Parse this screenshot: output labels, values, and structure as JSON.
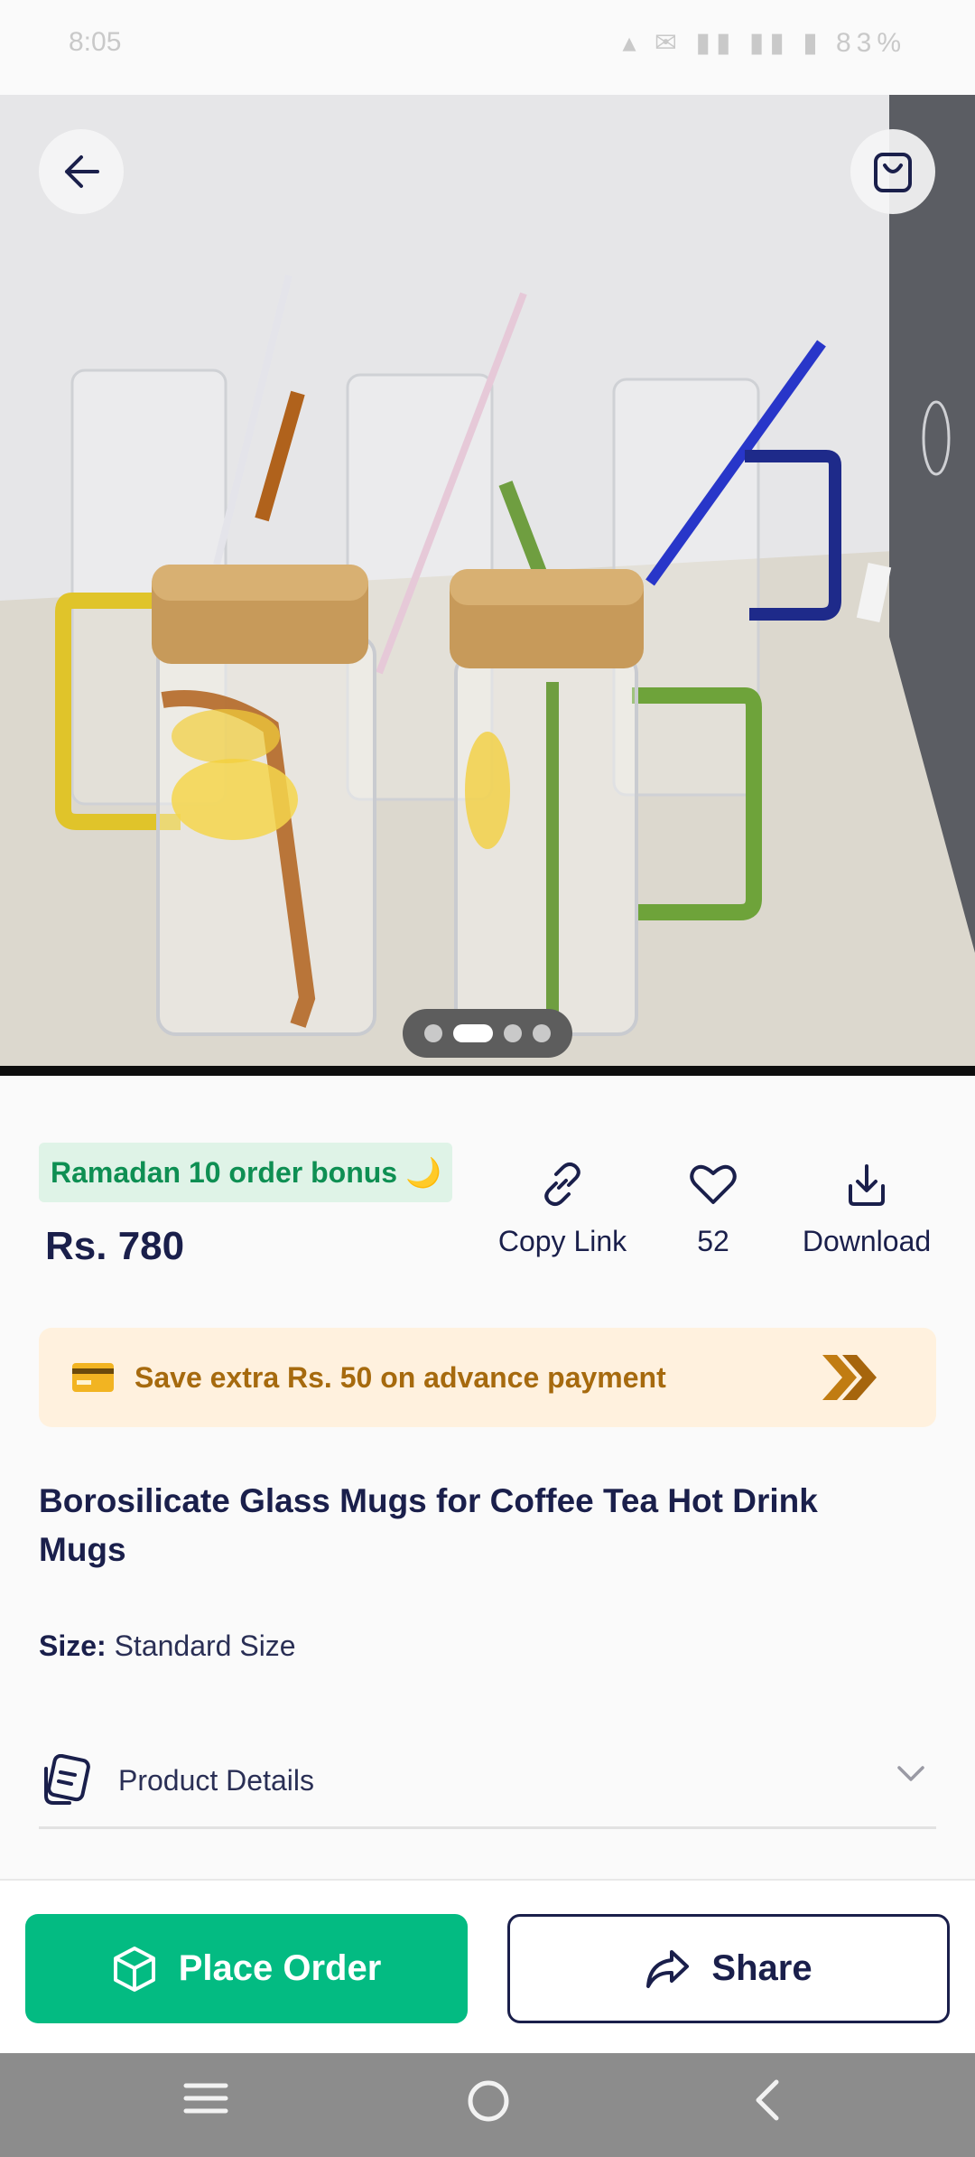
{
  "status_bar": {
    "time": "8:05",
    "indicators": "▴ ✉ ▮▮ ▮▮ ▮ 83%"
  },
  "header": {
    "back_icon": "arrow-left-icon",
    "cart_icon": "shopping-bag-icon"
  },
  "gallery": {
    "image_count": 4,
    "active_index": 1,
    "image_subject": "glass mugs with bamboo lids and glass straws"
  },
  "promo": {
    "bonus_label": "Ramadan 10 order bonus 🌙",
    "price": "Rs. 780"
  },
  "actions": [
    {
      "label": "Copy Link",
      "icon": "link-icon"
    },
    {
      "label": "52",
      "icon": "heart-icon"
    },
    {
      "label": "Download",
      "icon": "download-icon"
    }
  ],
  "advance_banner": {
    "text": "Save extra Rs. 50 on advance payment",
    "icon": "credit-card-icon",
    "accent": "#a66a0e"
  },
  "product": {
    "title": "Borosilicate Glass Mugs for Coffee Tea Hot Drink Mugs",
    "size_label": "Size:",
    "size_value": "Standard Size",
    "details_label": "Product Details"
  },
  "bottom_actions": {
    "order_label": "Place Order",
    "share_label": "Share",
    "order_color": "#03bb82"
  },
  "colors": {
    "navy": "#1a1f4b",
    "green": "#03bb82",
    "bonus_bg": "#dff3e7",
    "banner_bg": "#fff1de"
  }
}
